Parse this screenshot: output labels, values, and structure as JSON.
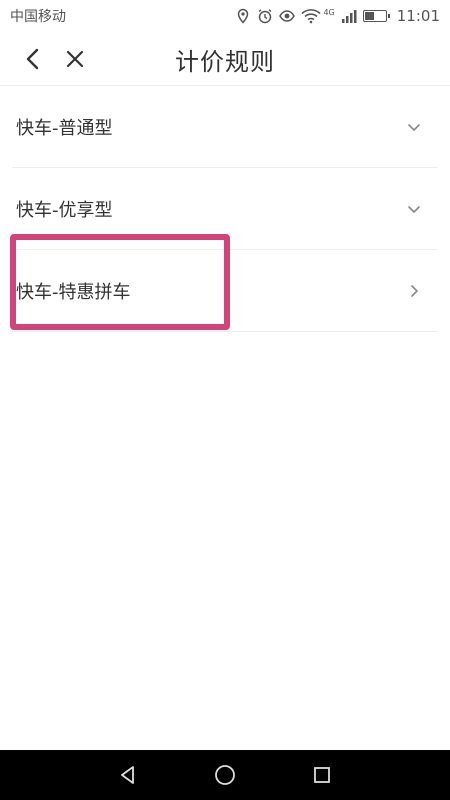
{
  "status_bar": {
    "carrier": "中国移动",
    "time": "11:01",
    "network_badge": "4G",
    "battery_level": 0.5,
    "icons": [
      "location-icon",
      "alarm-icon",
      "eye-icon",
      "wifi-icon",
      "signal-icon",
      "battery-icon"
    ]
  },
  "header": {
    "title": "计价规则"
  },
  "rules": [
    {
      "label": "快车-普通型",
      "chevron": "chevron-down-icon"
    },
    {
      "label": "快车-优享型",
      "chevron": "chevron-down-icon"
    },
    {
      "label": "快车-特惠拼车",
      "chevron": "chevron-right-icon"
    }
  ],
  "colors": {
    "highlight": "#d2437a",
    "text": "#333333",
    "divider": "#eeeeee",
    "nav_bar": "#000000"
  }
}
